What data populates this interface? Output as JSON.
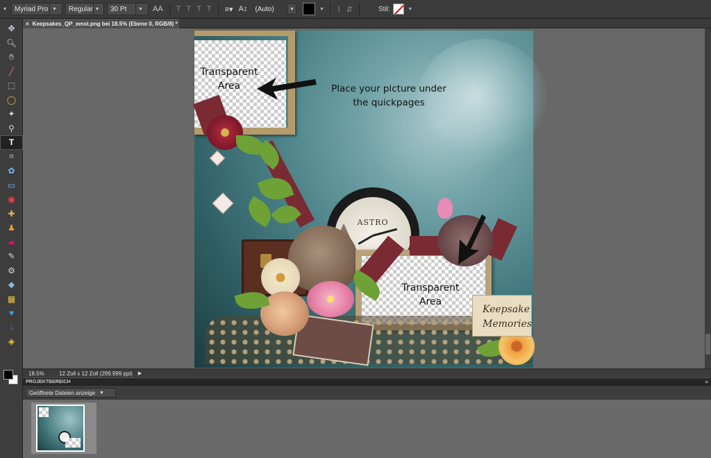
{
  "options_bar": {
    "font_family": "Myriad Pro",
    "font_style": "Regular",
    "font_size": "30 Pt",
    "leading": "(Auto)",
    "stil_label": "Stil:",
    "text_color": "#000000"
  },
  "document_tab": {
    "close_glyph": "×",
    "title": "Keepsakes_QP_emst.png bei 18.5% (Ebene 0, RGB/8) *"
  },
  "canvas": {
    "label_top_left": "Transparent Area",
    "label_bottom_right": "Transparent Area",
    "instructions": "Place your picture under the quickpages",
    "tag_text_1": "Keepsake",
    "tag_text_2": "Memories",
    "clock_text": "ASTRO"
  },
  "status_bar": {
    "zoom": "18.5%",
    "doc_info": "12 Zoll x 12 Zoll (299.999 ppi)"
  },
  "project_bin": {
    "title": "PROJEKTBEREICH",
    "filter_label": "Geöffnete Dateien anzeige"
  },
  "tools": [
    "move-tool",
    "zoom-tool",
    "hand-tool",
    "eyedropper-tool",
    "marquee-tool",
    "lasso-tool",
    "magic-wand-tool",
    "quick-selection-tool",
    "type-tool",
    "crop-tool",
    "cookie-cutter-tool",
    "straighten-tool",
    "red-eye-tool",
    "spot-healing-tool",
    "clone-stamp-tool",
    "eraser-tool",
    "brush-tool",
    "smart-brush-tool",
    "paint-bucket-tool",
    "gradient-tool",
    "custom-shape-tool",
    "blur-tool",
    "sponge-tool"
  ],
  "colors": {
    "foreground": "#000000",
    "background": "#ffffff",
    "canvas_bg": "#686868"
  }
}
